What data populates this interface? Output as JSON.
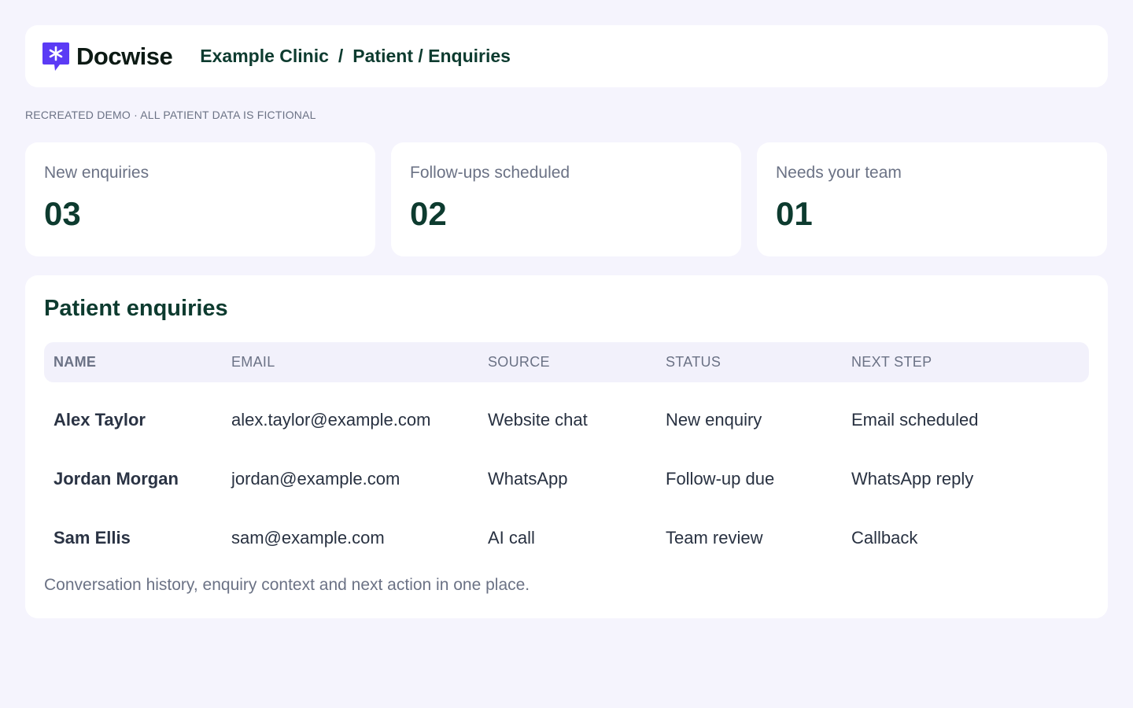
{
  "app": {
    "name": "Docwise",
    "colors": {
      "brand": "#5b3bf5",
      "accent_text": "#0d3b2f",
      "background": "#f5f4fd",
      "muted": "#6b7285"
    },
    "logo_icon": "speech-bubble-asterisk-icon"
  },
  "breadcrumb": {
    "clinic": "Example Clinic",
    "separator": "/",
    "section": "Patient / Enquiries"
  },
  "demo_note": "RECREATED DEMO · ALL PATIENT DATA IS FICTIONAL",
  "stats": [
    {
      "label": "New enquiries",
      "value": "03"
    },
    {
      "label": "Follow-ups scheduled",
      "value": "02"
    },
    {
      "label": "Needs your team",
      "value": "01"
    }
  ],
  "enquiries": {
    "title": "Patient enquiries",
    "columns": [
      "NAME",
      "EMAIL",
      "SOURCE",
      "STATUS",
      "NEXT STEP"
    ],
    "rows": [
      {
        "name": "Alex Taylor",
        "email": "alex.taylor@example.com",
        "source": "Website chat",
        "status": "New enquiry",
        "next_step": "Email scheduled"
      },
      {
        "name": "Jordan Morgan",
        "email": "jordan@example.com",
        "source": "WhatsApp",
        "status": "Follow-up due",
        "next_step": "WhatsApp reply"
      },
      {
        "name": "Sam Ellis",
        "email": "sam@example.com",
        "source": "AI call",
        "status": "Team review",
        "next_step": "Callback"
      }
    ],
    "footnote": "Conversation history, enquiry context and next action in one place."
  }
}
